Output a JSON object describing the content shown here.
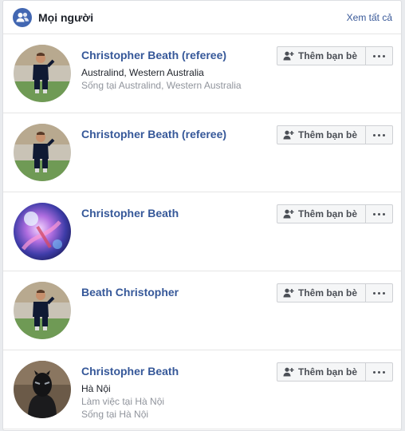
{
  "header": {
    "icon": "people-icon",
    "title": "Mọi người",
    "see_all": "Xem tất cả"
  },
  "people": [
    {
      "name": "Christopher Beath (referee)",
      "line1": "Australind, Western Australia",
      "line2": [
        "Sống tại Australind, Western Australia"
      ],
      "avatar": "referee-photo",
      "add_label": "Thêm bạn bè"
    },
    {
      "name": "Christopher Beath (referee)",
      "line1": "",
      "line2": [],
      "avatar": "referee-photo",
      "add_label": "Thêm bạn bè"
    },
    {
      "name": "Christopher Beath",
      "line1": "",
      "line2": [],
      "avatar": "galaxy-artwork",
      "add_label": "Thêm bạn bè"
    },
    {
      "name": "Beath Christopher",
      "line1": "",
      "line2": [],
      "avatar": "referee-photo",
      "add_label": "Thêm bạn bè"
    },
    {
      "name": "Christopher Beath",
      "line1": "Hà Nội",
      "line2": [
        "Làm việc tại Hà Nội",
        "Sống tại Hà Nội"
      ],
      "avatar": "black-panther-photo",
      "add_label": "Thêm bạn bè"
    }
  ]
}
